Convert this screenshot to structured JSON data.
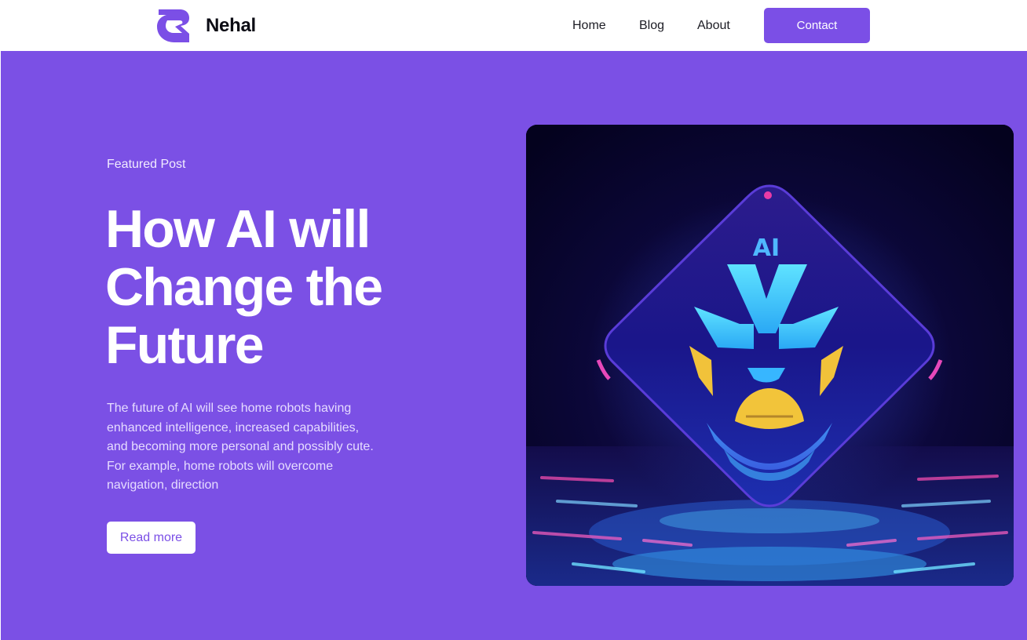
{
  "header": {
    "brand_name": "Nehal",
    "logo_icon": "nehal-logo-icon",
    "nav": [
      {
        "label": "Home"
      },
      {
        "label": "Blog"
      },
      {
        "label": "About"
      }
    ],
    "contact_label": "Contact"
  },
  "hero": {
    "eyebrow": "Featured Post",
    "title": "How AI will Change the Future",
    "description": "The future of AI will see home robots having enhanced intelligence, increased capabilities, and becoming more personal and possibly cute. For example, home robots will overcome navigation, direction",
    "read_more_label": "Read more",
    "image": {
      "icon": "ai-robot-mask-illustration",
      "label": "AI"
    }
  },
  "colors": {
    "accent": "#7b4fe6",
    "hero_background": "#7b50e5",
    "header_background": "#ffffff"
  }
}
